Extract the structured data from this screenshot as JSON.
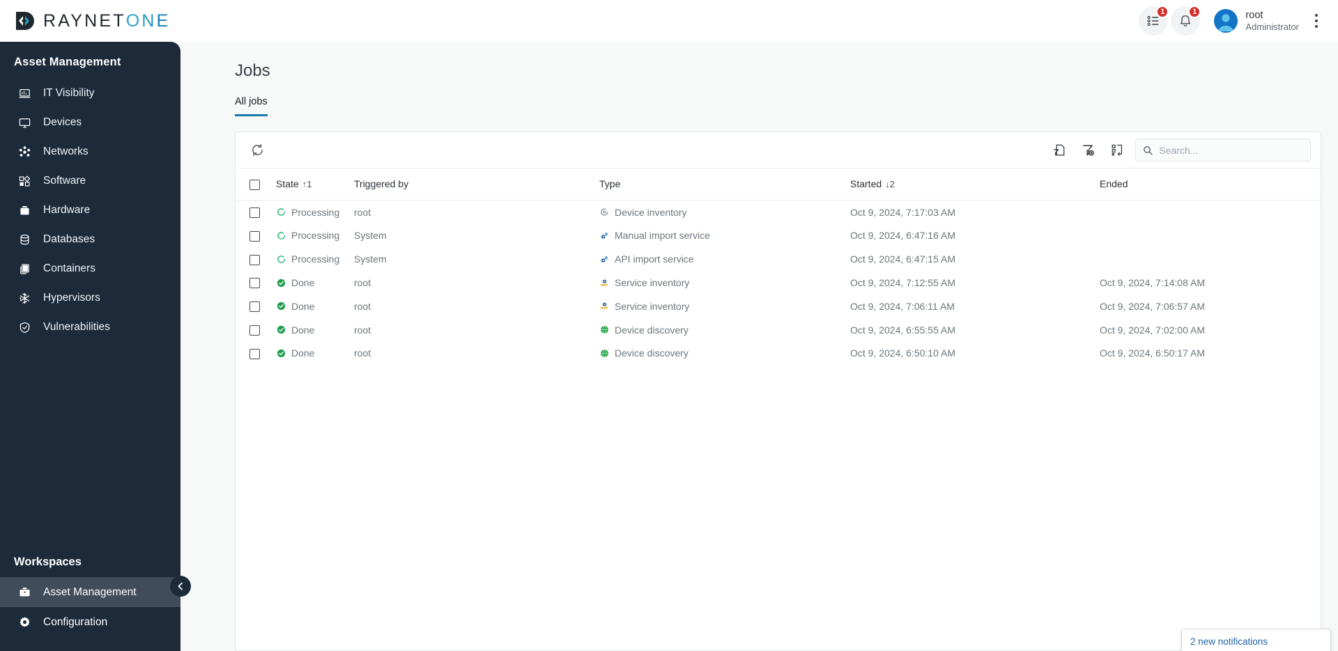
{
  "brand": {
    "name_part1": "RAYNET",
    "name_o": "O",
    "name_n": "N",
    "name_e": "E",
    "mark_icon": "raynet-logo-mark",
    "color_dark": "#20272e",
    "color_teal": "#28a3c9",
    "color_blue": "#1a7db5"
  },
  "topbar": {
    "tasks_icon": "task-list-icon",
    "tasks_badge": "1",
    "notifications_icon": "bell-icon",
    "notifications_badge": "1",
    "avatar_icon": "user-avatar",
    "user_name": "root",
    "user_role": "Administrator",
    "menu_icon": "kebab-menu-icon"
  },
  "sidebar": {
    "section_title": "Asset Management",
    "items": [
      {
        "label": "IT Visibility",
        "icon": "laptop-chart-icon"
      },
      {
        "label": "Devices",
        "icon": "monitor-icon"
      },
      {
        "label": "Networks",
        "icon": "network-nodes-icon"
      },
      {
        "label": "Software",
        "icon": "blocks-icon"
      },
      {
        "label": "Hardware",
        "icon": "hardware-case-icon"
      },
      {
        "label": "Databases",
        "icon": "database-icon"
      },
      {
        "label": "Containers",
        "icon": "containers-icon"
      },
      {
        "label": "Hypervisors",
        "icon": "hypervisor-icon"
      },
      {
        "label": "Vulnerabilities",
        "icon": "shield-check-icon"
      }
    ],
    "workspaces_title": "Workspaces",
    "workspaces": [
      {
        "label": "Asset Management",
        "icon": "briefcase-icon",
        "active": true
      },
      {
        "label": "Configuration",
        "icon": "gear-icon",
        "active": false
      }
    ],
    "collapse_icon": "chevron-left-icon",
    "background": "#1c2a3a"
  },
  "main": {
    "page_title": "Jobs",
    "tabs": [
      {
        "label": "All jobs",
        "active": true
      }
    ],
    "accent_color": "#1677ab"
  },
  "toolbar": {
    "refresh_icon": "refresh-icon",
    "save_filter_icon": "save-filter-icon",
    "clear_filter_icon": "clear-filter-icon",
    "reset_columns_icon": "reset-columns-icon",
    "search_icon": "search-icon",
    "search_placeholder": "Search...",
    "search_value": ""
  },
  "table": {
    "select_all_icon": "checkbox-unchecked",
    "columns": [
      {
        "key": "state",
        "label": "State",
        "sort": "↑1"
      },
      {
        "key": "trigger",
        "label": "Triggered by",
        "sort": ""
      },
      {
        "key": "type",
        "label": "Type",
        "sort": ""
      },
      {
        "key": "started",
        "label": "Started",
        "sort": "↓2"
      },
      {
        "key": "ended",
        "label": "Ended",
        "sort": ""
      }
    ],
    "rows": [
      {
        "state": "Processing",
        "state_icon": "spinner-icon",
        "trigger": "root",
        "type": "Device inventory",
        "type_icon": "device-inventory-icon",
        "started": "Oct 9, 2024, 7:17:03 AM",
        "ended": ""
      },
      {
        "state": "Processing",
        "state_icon": "spinner-icon",
        "trigger": "System",
        "type": "Manual import service",
        "type_icon": "import-service-icon",
        "started": "Oct 9, 2024, 6:47:16 AM",
        "ended": ""
      },
      {
        "state": "Processing",
        "state_icon": "spinner-icon",
        "trigger": "System",
        "type": "API import service",
        "type_icon": "import-service-icon",
        "started": "Oct 9, 2024, 6:47:15 AM",
        "ended": ""
      },
      {
        "state": "Done",
        "state_icon": "check-circle-icon",
        "trigger": "root",
        "type": "Service inventory",
        "type_icon": "service-inventory-icon",
        "started": "Oct 9, 2024, 7:12:55 AM",
        "ended": "Oct 9, 2024, 7:14:08 AM"
      },
      {
        "state": "Done",
        "state_icon": "check-circle-icon",
        "trigger": "root",
        "type": "Service inventory",
        "type_icon": "service-inventory-icon",
        "started": "Oct 9, 2024, 7:06:11 AM",
        "ended": "Oct 9, 2024, 7:06:57 AM"
      },
      {
        "state": "Done",
        "state_icon": "check-circle-icon",
        "trigger": "root",
        "type": "Device discovery",
        "type_icon": "device-discovery-icon",
        "started": "Oct 9, 2024, 6:55:55 AM",
        "ended": "Oct 9, 2024, 7:02:00 AM"
      },
      {
        "state": "Done",
        "state_icon": "check-circle-icon",
        "trigger": "root",
        "type": "Device discovery",
        "type_icon": "device-discovery-icon",
        "started": "Oct 9, 2024, 6:50:10 AM",
        "ended": "Oct 9, 2024, 6:50:17 AM"
      }
    ],
    "row_checkbox_icon": "checkbox-unchecked",
    "processing_color": "#35b77f",
    "done_color": "#1f9d4f"
  },
  "toast": {
    "text": "2 new notifications"
  }
}
